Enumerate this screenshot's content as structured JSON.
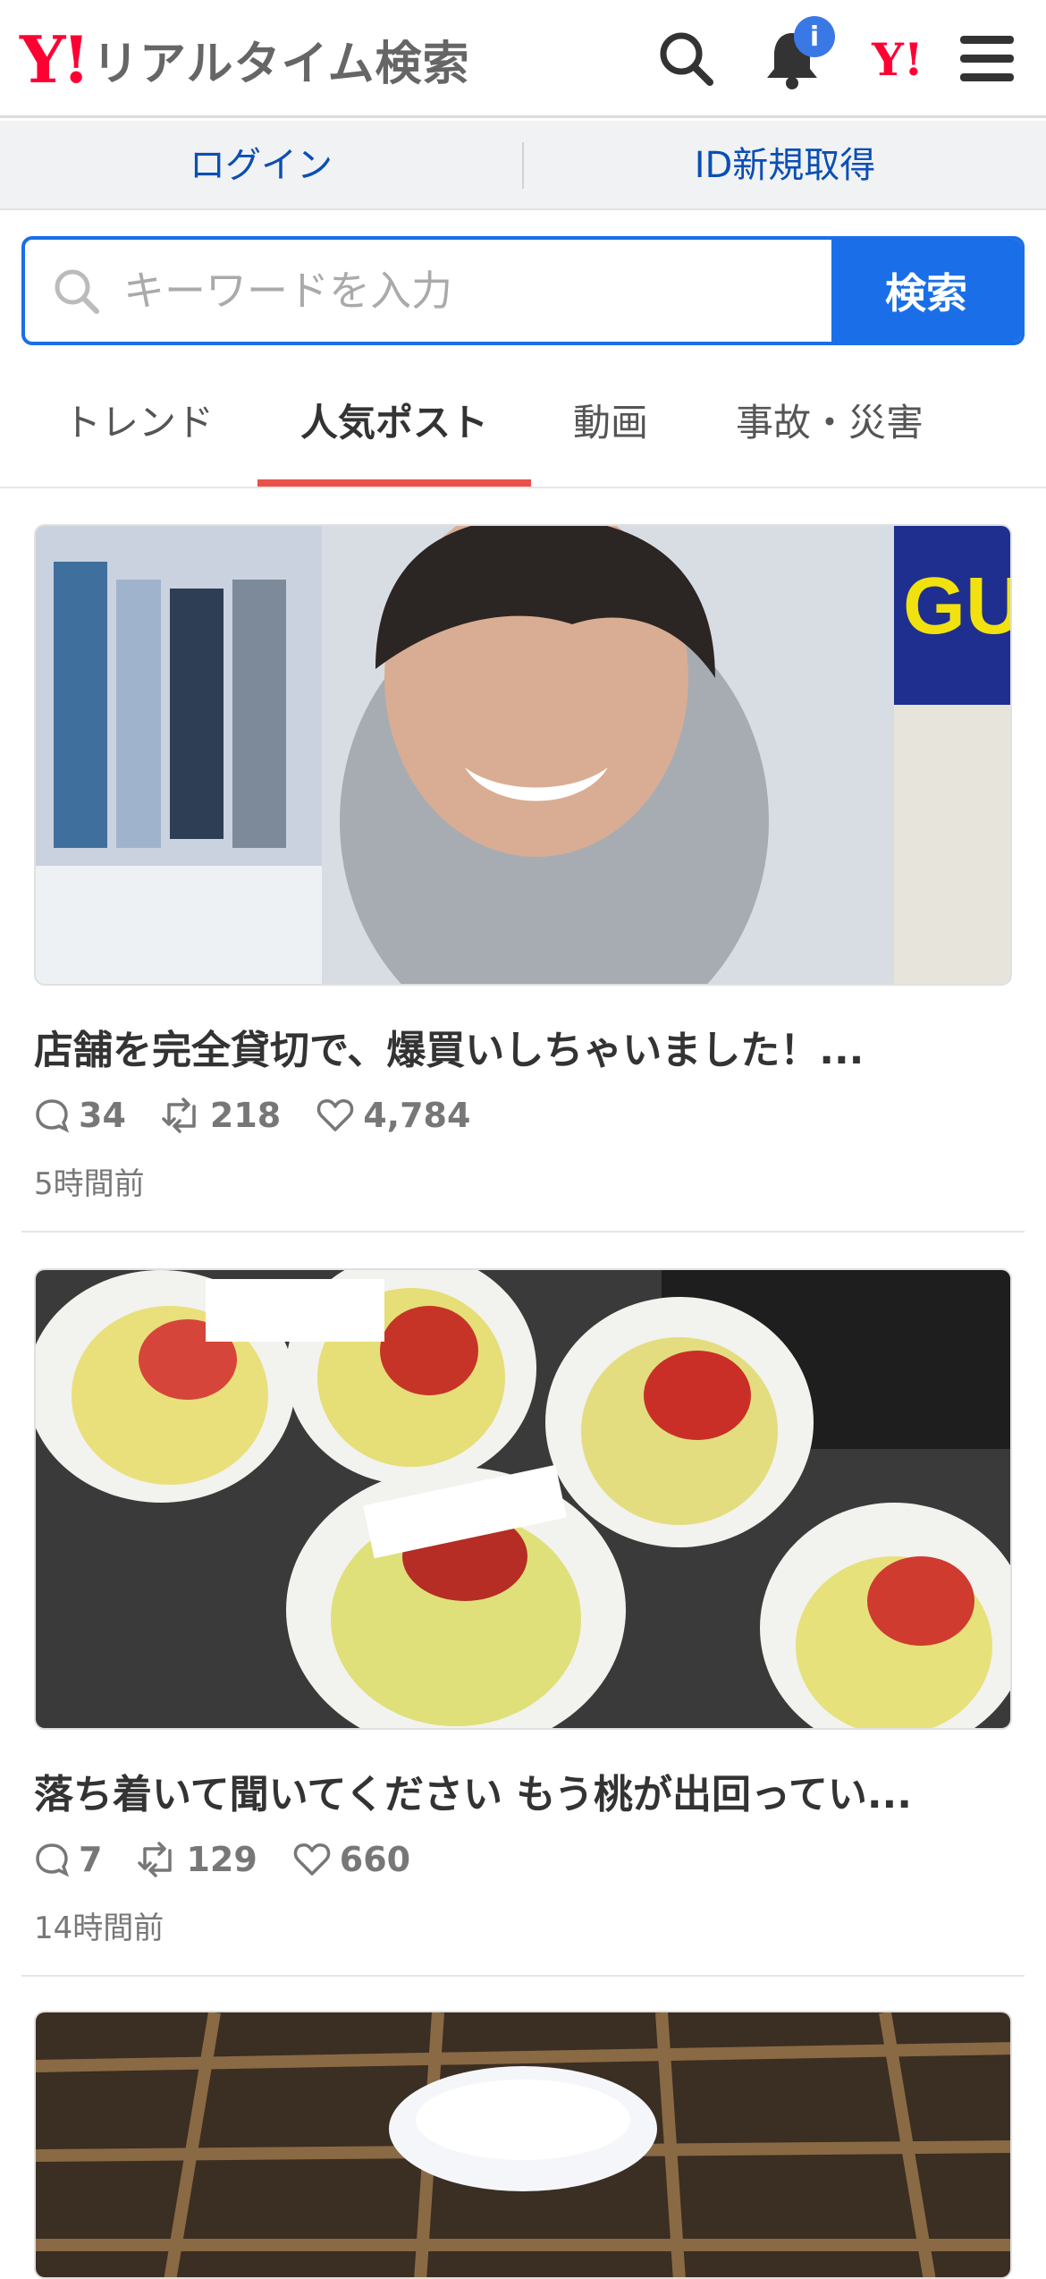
{
  "header": {
    "logo_y": "Y!",
    "logo_text": "リアルタイム検索",
    "notification_badge": "i",
    "mini_logo": "Y!",
    "icons": [
      "search-icon",
      "bell-icon",
      "yahoo-logo-icon",
      "hamburger-menu-icon"
    ]
  },
  "auth": {
    "login": "ログイン",
    "register": "ID新規取得"
  },
  "search": {
    "placeholder": "キーワードを入力",
    "value": "",
    "button": "検索"
  },
  "tabs": [
    {
      "label": "トレンド",
      "active": false
    },
    {
      "label": "人気ポスト",
      "active": true
    },
    {
      "label": "動画",
      "active": false
    },
    {
      "label": "事故・災害",
      "active": false
    }
  ],
  "accent_colors": {
    "brand_red": "#ff0033",
    "link_blue": "#0a4fb5",
    "search_blue": "#1a6fe8",
    "tab_underline": "#e8524a"
  },
  "posts": [
    {
      "title": "店舗を完全貸切で、爆買いしちゃいました！...",
      "replies": "34",
      "reposts": "218",
      "likes": "4,784",
      "time": "5時間前"
    },
    {
      "title": "落ち着いて聞いてください もう桃が出回ってい...",
      "replies": "7",
      "reposts": "129",
      "likes": "660",
      "time": "14時間前"
    },
    {
      "title": "",
      "replies": "",
      "reposts": "",
      "likes": "",
      "time": ""
    }
  ]
}
